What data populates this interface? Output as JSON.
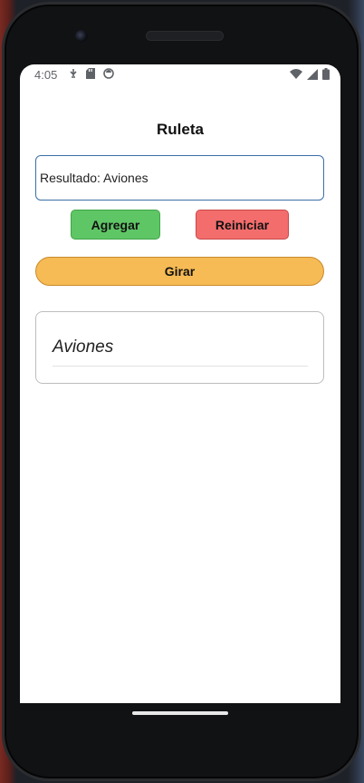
{
  "status_bar": {
    "time": "4:05",
    "left_icons": [
      "usb-debug-icon",
      "sd-card-icon",
      "sync-icon"
    ],
    "right_icons": [
      "wifi-icon",
      "signal-icon",
      "battery-icon"
    ]
  },
  "app": {
    "title": "Ruleta",
    "result_field": {
      "value": "Resultado: Aviones",
      "placeholder": ""
    },
    "buttons": {
      "add_label": "Agregar",
      "reset_label": "Reiniciar",
      "spin_label": "Girar"
    },
    "list": {
      "items": [
        {
          "label": "Aviones"
        }
      ]
    }
  },
  "colors": {
    "add_button": "#5fc666",
    "reset_button": "#f36d6d",
    "spin_button": "#f6bb55",
    "input_border": "#3b6fa8"
  }
}
